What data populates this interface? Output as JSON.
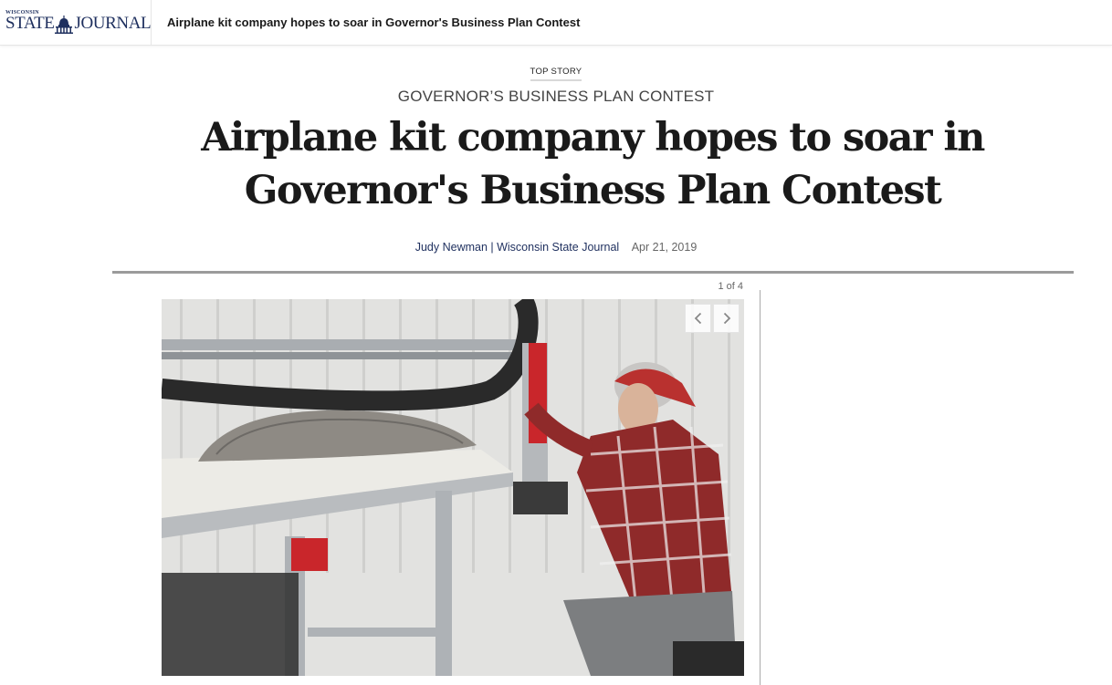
{
  "topbar": {
    "logo_small": "WISCONSIN",
    "logo_word_left": "STATE",
    "logo_word_right": "JOURNAL",
    "title": "Airplane kit company hopes to soar in Governor's Business Plan Contest"
  },
  "article": {
    "kicker": "TOP STORY",
    "section": "GOVERNOR’S BUSINESS PLAN CONTEST",
    "headline": "Airplane kit company hopes to soar in Governor's Business Plan Contest",
    "author": "Judy Newman | Wisconsin State Journal",
    "date": "Apr 21, 2019"
  },
  "gallery": {
    "counter": "1 of 4",
    "current": 1,
    "total": 4
  },
  "colors": {
    "brand_navy": "#1e2f5e",
    "rule_gray": "#9b9b9b"
  }
}
